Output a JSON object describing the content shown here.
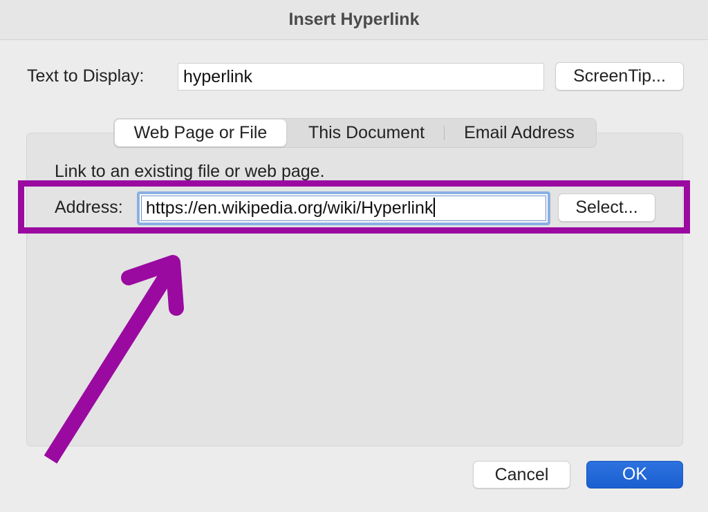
{
  "dialog": {
    "title": "Insert Hyperlink"
  },
  "display_text": {
    "label": "Text to Display:",
    "value": "hyperlink"
  },
  "screentip_button": "ScreenTip...",
  "tabs": [
    {
      "label": "Web Page or File",
      "active": true
    },
    {
      "label": "This Document",
      "active": false
    },
    {
      "label": "Email Address",
      "active": false
    }
  ],
  "panel": {
    "description": "Link to an existing file or web page.",
    "address_label": "Address:",
    "address_value": "https://en.wikipedia.org/wiki/Hyperlink",
    "select_button": "Select..."
  },
  "footer": {
    "cancel_label": "Cancel",
    "ok_label": "OK"
  },
  "colors": {
    "annotation": "#9a0aa0",
    "primary_button": "#1a5fd1",
    "focus_ring": "#8ab0e4"
  }
}
